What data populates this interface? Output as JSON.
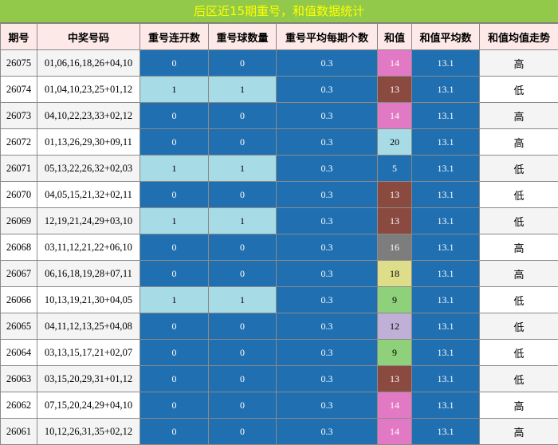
{
  "title": "后区近15期重号，和值数据统计",
  "headers": [
    "期号",
    "中奖号码",
    "重号连开数",
    "重号球数量",
    "重号平均每期个数",
    "和值",
    "和值平均数",
    "和值均值走势"
  ],
  "colors": {
    "title_bg": "#92c94a",
    "title_text": "#ffff00",
    "header_bg": "#fde9e7",
    "blue": "#1f6fb1",
    "light_blue": "#a7dbe6",
    "sum_14": "#e279c4",
    "sum_13": "#8a4a3f",
    "sum_20": "#a7dbe6",
    "sum_5": "#1f6fb1",
    "sum_16": "#7d7d7d",
    "sum_18": "#dedd8a",
    "sum_9": "#8fd07a",
    "sum_12": "#c0b0d8"
  },
  "rows": [
    {
      "id": "26075",
      "nums": "01,06,16,18,26+04,10",
      "consec": "0",
      "count": "0",
      "avg": "0.3",
      "sum": "14",
      "sum_color": "#e279c4",
      "sum_text": "#ffffff",
      "sum_avg": "13.1",
      "trend": "高"
    },
    {
      "id": "26074",
      "nums": "01,04,10,23,25+01,12",
      "consec": "1",
      "count": "1",
      "avg": "0.3",
      "sum": "13",
      "sum_color": "#8a4a3f",
      "sum_text": "#ffffff",
      "sum_avg": "13.1",
      "trend": "低"
    },
    {
      "id": "26073",
      "nums": "04,10,22,23,33+02,12",
      "consec": "0",
      "count": "0",
      "avg": "0.3",
      "sum": "14",
      "sum_color": "#e279c4",
      "sum_text": "#ffffff",
      "sum_avg": "13.1",
      "trend": "高"
    },
    {
      "id": "26072",
      "nums": "01,13,26,29,30+09,11",
      "consec": "0",
      "count": "0",
      "avg": "0.3",
      "sum": "20",
      "sum_color": "#a7dbe6",
      "sum_text": "#000000",
      "sum_avg": "13.1",
      "trend": "高"
    },
    {
      "id": "26071",
      "nums": "05,13,22,26,32+02,03",
      "consec": "1",
      "count": "1",
      "avg": "0.3",
      "sum": "5",
      "sum_color": "#1f6fb1",
      "sum_text": "#ffffff",
      "sum_avg": "13.1",
      "trend": "低"
    },
    {
      "id": "26070",
      "nums": "04,05,15,21,32+02,11",
      "consec": "0",
      "count": "0",
      "avg": "0.3",
      "sum": "13",
      "sum_color": "#8a4a3f",
      "sum_text": "#ffffff",
      "sum_avg": "13.1",
      "trend": "低"
    },
    {
      "id": "26069",
      "nums": "12,19,21,24,29+03,10",
      "consec": "1",
      "count": "1",
      "avg": "0.3",
      "sum": "13",
      "sum_color": "#8a4a3f",
      "sum_text": "#ffffff",
      "sum_avg": "13.1",
      "trend": "低"
    },
    {
      "id": "26068",
      "nums": "03,11,12,21,22+06,10",
      "consec": "0",
      "count": "0",
      "avg": "0.3",
      "sum": "16",
      "sum_color": "#7d7d7d",
      "sum_text": "#ffffff",
      "sum_avg": "13.1",
      "trend": "高"
    },
    {
      "id": "26067",
      "nums": "06,16,18,19,28+07,11",
      "consec": "0",
      "count": "0",
      "avg": "0.3",
      "sum": "18",
      "sum_color": "#dedd8a",
      "sum_text": "#000000",
      "sum_avg": "13.1",
      "trend": "高"
    },
    {
      "id": "26066",
      "nums": "10,13,19,21,30+04,05",
      "consec": "1",
      "count": "1",
      "avg": "0.3",
      "sum": "9",
      "sum_color": "#8fd07a",
      "sum_text": "#000000",
      "sum_avg": "13.1",
      "trend": "低"
    },
    {
      "id": "26065",
      "nums": "04,11,12,13,25+04,08",
      "consec": "0",
      "count": "0",
      "avg": "0.3",
      "sum": "12",
      "sum_color": "#c0b0d8",
      "sum_text": "#000000",
      "sum_avg": "13.1",
      "trend": "低"
    },
    {
      "id": "26064",
      "nums": "03,13,15,17,21+02,07",
      "consec": "0",
      "count": "0",
      "avg": "0.3",
      "sum": "9",
      "sum_color": "#8fd07a",
      "sum_text": "#000000",
      "sum_avg": "13.1",
      "trend": "低"
    },
    {
      "id": "26063",
      "nums": "03,15,20,29,31+01,12",
      "consec": "0",
      "count": "0",
      "avg": "0.3",
      "sum": "13",
      "sum_color": "#8a4a3f",
      "sum_text": "#ffffff",
      "sum_avg": "13.1",
      "trend": "低"
    },
    {
      "id": "26062",
      "nums": "07,15,20,24,29+04,10",
      "consec": "0",
      "count": "0",
      "avg": "0.3",
      "sum": "14",
      "sum_color": "#e279c4",
      "sum_text": "#ffffff",
      "sum_avg": "13.1",
      "trend": "高"
    },
    {
      "id": "26061",
      "nums": "10,12,26,31,35+02,12",
      "consec": "0",
      "count": "0",
      "avg": "0.3",
      "sum": "14",
      "sum_color": "#e279c4",
      "sum_text": "#ffffff",
      "sum_avg": "13.1",
      "trend": "高"
    }
  ]
}
